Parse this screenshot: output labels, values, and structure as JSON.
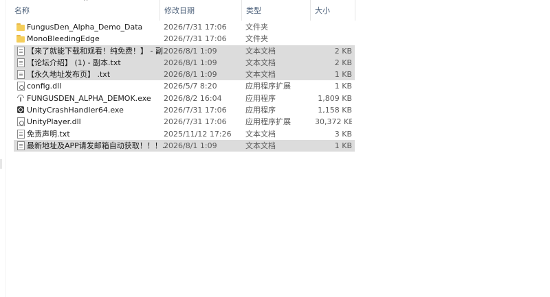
{
  "columns": {
    "name": "名称",
    "date": "修改日期",
    "type": "类型",
    "size": "大小"
  },
  "sort_indicator": "^",
  "files": [
    {
      "icon": "folder-icon",
      "name": "FungusDen_Alpha_Demo_Data",
      "date": "2026/7/31 17:06",
      "type": "文件夹",
      "size": "",
      "selected": false
    },
    {
      "icon": "folder-icon",
      "name": "MonoBleedingEdge",
      "date": "2026/7/31 17:06",
      "type": "文件夹",
      "size": "",
      "selected": false
    },
    {
      "icon": "text-file-icon",
      "name": "【来了就能下载和观看！纯免费！】 - 副...",
      "date": "2026/8/1 1:09",
      "type": "文本文档",
      "size": "2 KB",
      "selected": true
    },
    {
      "icon": "text-file-icon",
      "name": "【论坛介绍】 (1) - 副本.txt",
      "date": "2026/8/1 1:09",
      "type": "文本文档",
      "size": "2 KB",
      "selected": true
    },
    {
      "icon": "text-file-icon",
      "name": "【永久地址发布页】 .txt",
      "date": "2026/8/1 1:09",
      "type": "文本文档",
      "size": "1 KB",
      "selected": true
    },
    {
      "icon": "dll-file-icon",
      "name": "config.dll",
      "date": "2026/5/7 8:20",
      "type": "应用程序扩展",
      "size": "1 KB",
      "selected": false
    },
    {
      "icon": "fungus-exe-icon",
      "name": "FUNGUSDEN_ALPHA_DEMOK.exe",
      "date": "2026/8/2 16:04",
      "type": "应用程序",
      "size": "1,809 KB",
      "selected": false
    },
    {
      "icon": "unity-exe-icon",
      "name": "UnityCrashHandler64.exe",
      "date": "2026/7/31 17:06",
      "type": "应用程序",
      "size": "1,158 KB",
      "selected": false
    },
    {
      "icon": "dll-file-icon",
      "name": "UnityPlayer.dll",
      "date": "2026/7/31 17:06",
      "type": "应用程序扩展",
      "size": "30,372 KB",
      "selected": false
    },
    {
      "icon": "text-file-icon",
      "name": "免责声明.txt",
      "date": "2025/11/12 17:26",
      "type": "文本文档",
      "size": "3 KB",
      "selected": false
    },
    {
      "icon": "text-file-icon",
      "name": "最新地址及APP请发邮箱自动获取！！！...",
      "date": "2026/8/1 1:09",
      "type": "文本文档",
      "size": "1 KB",
      "selected": true
    }
  ]
}
